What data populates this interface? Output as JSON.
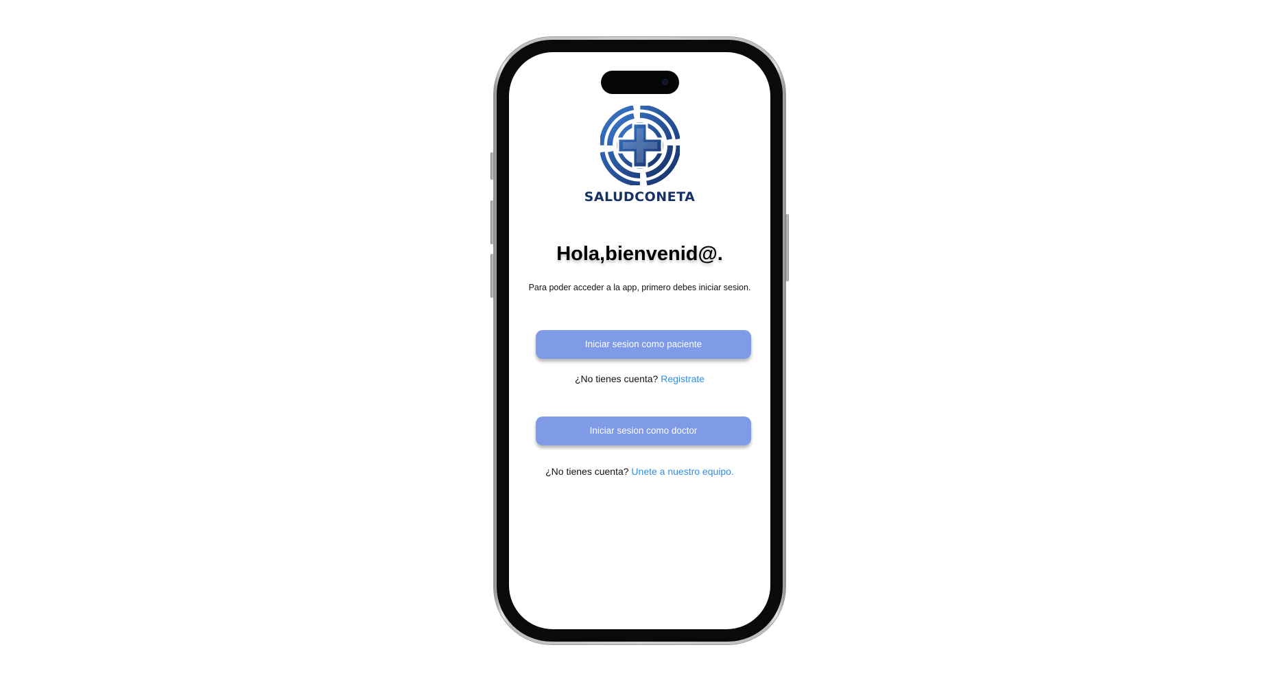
{
  "brand": {
    "name": "SALUDCONETA",
    "logo_icon": "medical-cross-icon",
    "colors": {
      "logo_primary": "#16306a",
      "logo_light": "#3a78c9"
    }
  },
  "welcome": {
    "title": "Hola,bienvenid@.",
    "subtitle": "Para poder acceder a la app, primero debes iniciar sesion."
  },
  "patient": {
    "login_label": "Iniciar sesion como paciente",
    "no_account_text": "¿No tienes cuenta?",
    "register_link": "Registrate"
  },
  "doctor": {
    "login_label": "Iniciar sesion como doctor",
    "no_account_text": "¿No tienes cuenta?",
    "join_link": "Unete a nuestro equipo."
  },
  "colors": {
    "button_bg": "#7f9be8",
    "button_text": "#ffffff",
    "link": "#2e8ee6"
  }
}
